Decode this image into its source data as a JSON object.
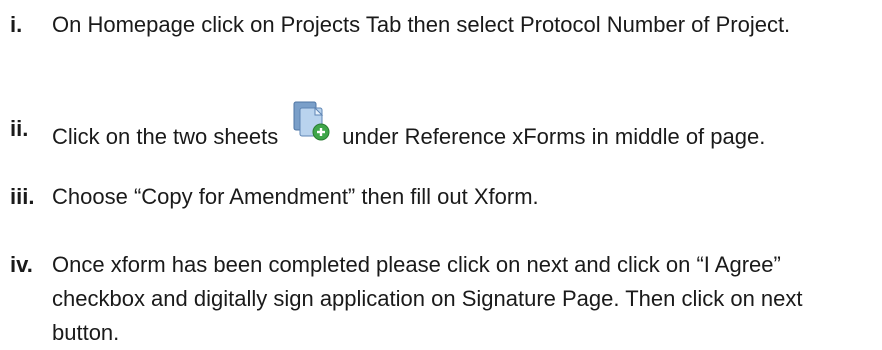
{
  "steps": [
    {
      "number": "i.",
      "text": "On Homepage click on Projects Tab then select Protocol Number of Project."
    },
    {
      "number": "ii.",
      "text_before": "Click on the two sheets",
      "icon": "copy-sheets-add-icon",
      "text_after": "under Reference xForms in middle of page."
    },
    {
      "number": "iii.",
      "text": "Choose “Copy for Amendment” then fill out Xform."
    },
    {
      "number": "iv.",
      "text": "Once xform has been completed please click on next and click on “I Agree” checkbox and digitally sign application on Signature Page. Then click on next button."
    }
  ],
  "colors": {
    "text": "#1a1a1a",
    "icon_sheet_back": "#7a9fc9",
    "icon_sheet_front": "#b9d3ee",
    "icon_plus": "#3fa64a"
  }
}
